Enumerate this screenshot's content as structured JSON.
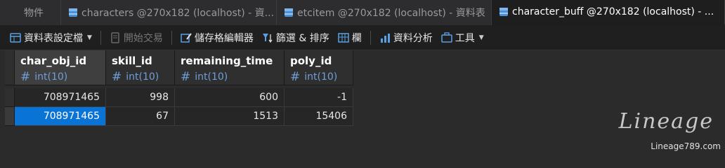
{
  "tabs": [
    {
      "label": "物件"
    },
    {
      "label": "characters @270x182 (localhost) - 資..."
    },
    {
      "label": "etcitem @270x182 (localhost) - 資料表"
    },
    {
      "label": "character_buff @270x182 (localhost) - ..."
    }
  ],
  "toolbar": {
    "table_design": "資料表設定檔",
    "begin_transaction": "開始交易",
    "storage_editor": "儲存格編輯器",
    "filter_sort": "篩選 & 排序",
    "columns": "欄",
    "data_analysis": "資料分析",
    "tools": "工具"
  },
  "grid": {
    "columns": [
      {
        "name": "char_obj_id",
        "type": "int(10)"
      },
      {
        "name": "skill_id",
        "type": "int(10)"
      },
      {
        "name": "remaining_time",
        "type": "int(10)"
      },
      {
        "name": "poly_id",
        "type": "int(10)"
      }
    ],
    "rows": [
      [
        "708971465",
        "998",
        "600",
        "-1"
      ],
      [
        "708971465",
        "67",
        "1513",
        "15406"
      ]
    ]
  },
  "watermark": {
    "logo": "Lineage",
    "url": "Lineage789.com"
  },
  "colors": {
    "selection": "#0a74d6",
    "type_text": "#6f9fd8",
    "background": "#2b2b2b"
  }
}
